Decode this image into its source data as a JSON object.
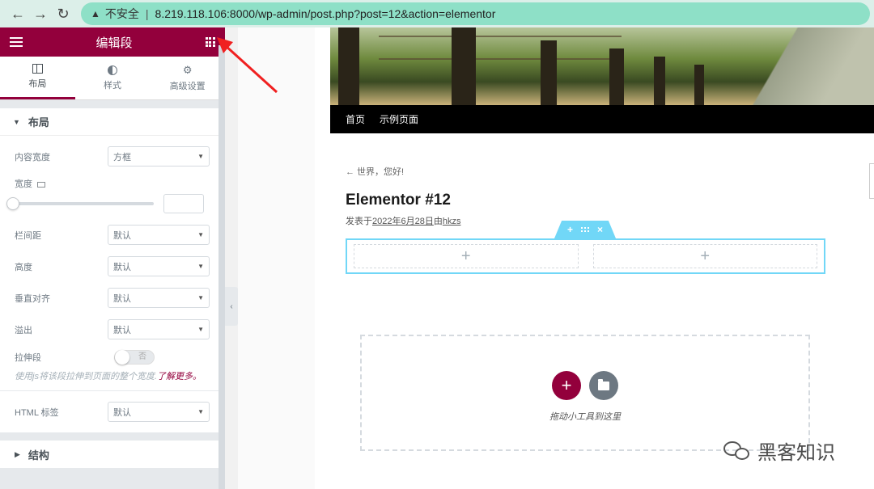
{
  "browser": {
    "back": "←",
    "forward": "→",
    "reload": "↻",
    "warning": "▲",
    "insecure": "不安全",
    "separator": "|",
    "url": "8.219.118.106:8000/wp-admin/post.php?post=12&action=elementor"
  },
  "panel": {
    "title": "编辑段",
    "tabs": [
      {
        "label": "布局"
      },
      {
        "label": "样式"
      },
      {
        "label": "高级设置"
      }
    ],
    "layout_section": "布局",
    "content_width": {
      "label": "内容宽度",
      "value": "方框"
    },
    "width": {
      "label": "宽度",
      "value": 0
    },
    "gap": {
      "label": "栏间距",
      "value": "默认"
    },
    "height": {
      "label": "高度",
      "value": "默认"
    },
    "valign": {
      "label": "垂直对齐",
      "value": "默认"
    },
    "overflow": {
      "label": "溢出",
      "value": "默认"
    },
    "stretch": {
      "label": "拉伸段",
      "toggle": "否"
    },
    "help_text": "使用js将该段拉伸到页面的整个宽度.",
    "learn_more": "了解更多。",
    "html_tag": {
      "label": "HTML 标签",
      "value": "默认"
    },
    "structure_section": "结构",
    "collapse": "‹"
  },
  "preview": {
    "nav": [
      "首页",
      "示例页面"
    ],
    "back_link": "← 世界，您好!",
    "post_title": "Elementor #12",
    "meta_prefix": "发表于",
    "meta_date": "2022年6月28日",
    "meta_by": "由",
    "meta_author": "hkzs",
    "section_tab": {
      "add": "+",
      "close": "×"
    },
    "column_add": "+",
    "drop_add": "+",
    "drop_text": "拖动小工具到这里"
  },
  "watermark": "黑客知识",
  "colors": {
    "brand": "#93003c",
    "section": "#71d7f7",
    "annotation": "#f02020"
  }
}
